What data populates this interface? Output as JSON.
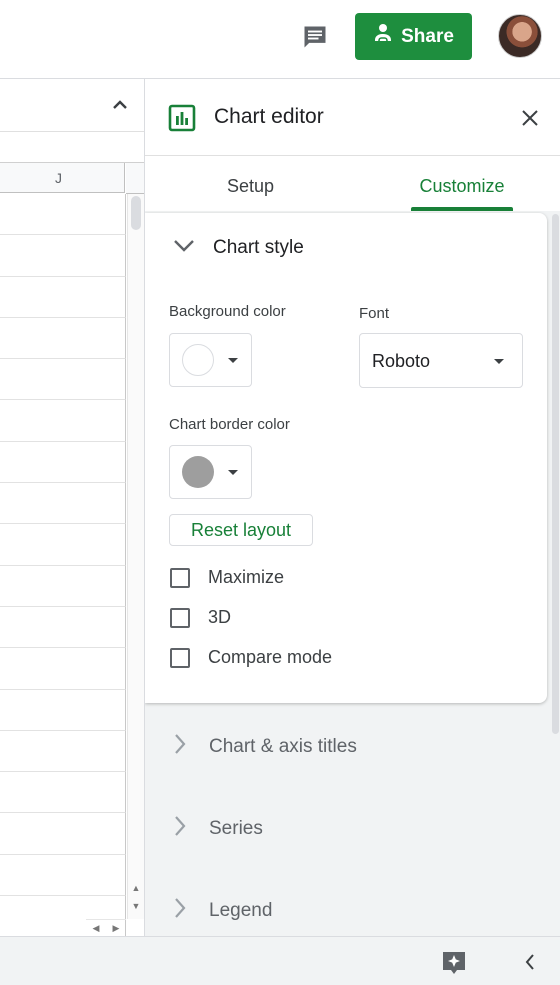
{
  "topbar": {
    "comment_icon": "comment-icon",
    "share_label": "Share",
    "share_icon": "person-link-icon",
    "avatar": "user-avatar",
    "accent": "#1e8e3e"
  },
  "sheet": {
    "column_label": "J",
    "collapse_icon": "chevron-up-icon"
  },
  "chart_editor": {
    "title": "Chart editor",
    "icon": "bar-chart-icon",
    "close_icon": "close-icon",
    "tabs": [
      {
        "label": "Setup",
        "active": false
      },
      {
        "label": "Customize",
        "active": true
      }
    ],
    "chart_style": {
      "title": "Chart style",
      "background_color_label": "Background color",
      "background_color": "#ffffff",
      "font_label": "Font",
      "font_value": "Roboto",
      "border_color_label": "Chart border color",
      "border_color": "#9e9e9e",
      "reset_layout_label": "Reset layout",
      "checkboxes": [
        {
          "label": "Maximize",
          "checked": false
        },
        {
          "label": "3D",
          "checked": false
        },
        {
          "label": "Compare mode",
          "checked": false
        }
      ]
    },
    "collapsed_sections": [
      {
        "label": "Chart & axis titles"
      },
      {
        "label": "Series"
      },
      {
        "label": "Legend"
      }
    ],
    "accent": "#188038"
  },
  "bottombar": {
    "explore_icon": "explore-sparkle-icon",
    "side_panel_icon": "chevron-left-icon"
  }
}
